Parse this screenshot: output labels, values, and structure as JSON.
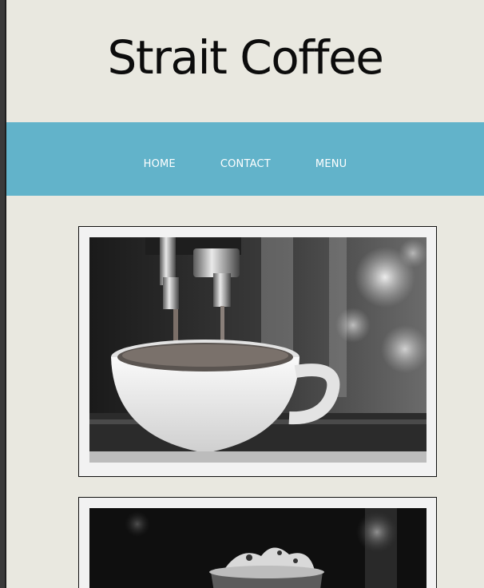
{
  "site": {
    "title": "Strait Coffee"
  },
  "nav": {
    "items": [
      {
        "label": "HOME"
      },
      {
        "label": "CONTACT"
      },
      {
        "label": "MENU"
      }
    ]
  },
  "gallery": {
    "images": [
      {
        "subject": "espresso-pour-photo"
      },
      {
        "subject": "latte-glass-photo"
      }
    ]
  },
  "colors": {
    "background": "#e9e8e0",
    "nav_background": "#62b3ca",
    "nav_text": "#ffffff",
    "title_text": "#0c0c0c",
    "card_border": "#111111",
    "card_background": "#f2f2f2"
  }
}
